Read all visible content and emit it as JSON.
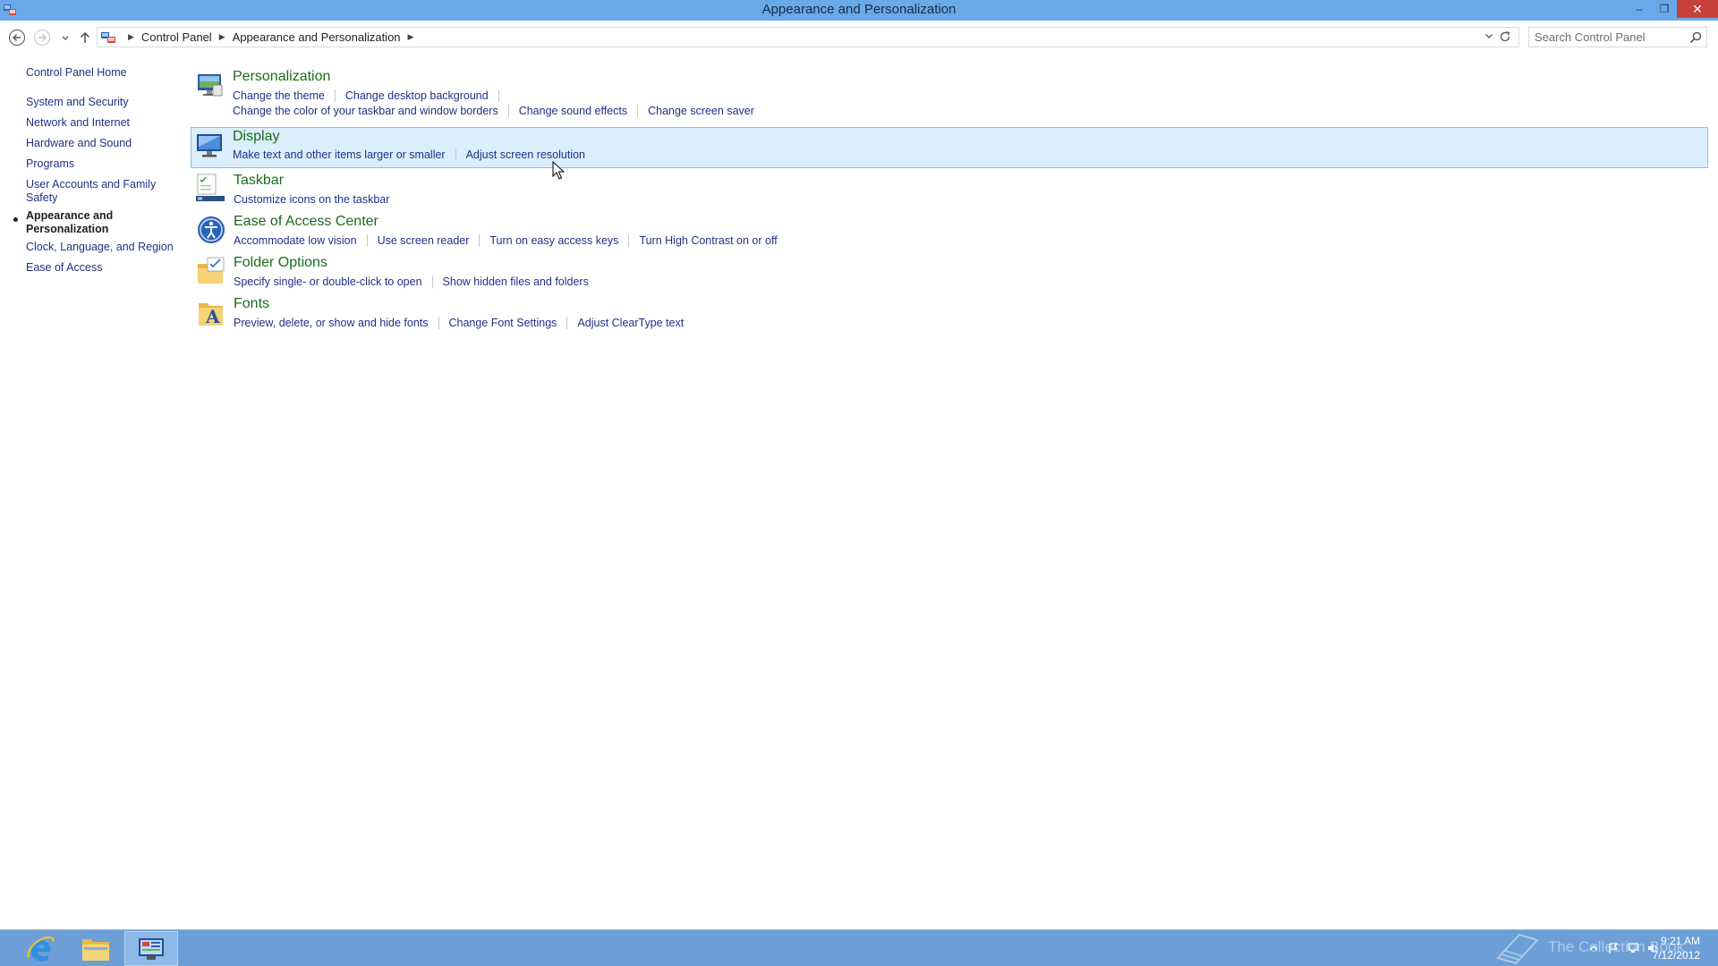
{
  "window": {
    "title": "Appearance and Personalization",
    "minimize": "–",
    "restore": "❐",
    "close": "✕"
  },
  "address": {
    "breadcrumbs": [
      "Control Panel",
      "Appearance and Personalization"
    ],
    "search_placeholder": "Search Control Panel"
  },
  "leftnav": {
    "home": "Control Panel Home",
    "items": [
      "System and Security",
      "Network and Internet",
      "Hardware and Sound",
      "Programs",
      "User Accounts and Family Safety",
      "Appearance and Personalization",
      "Clock, Language, and Region",
      "Ease of Access"
    ],
    "current": "Appearance and Personalization"
  },
  "categories": [
    {
      "title": "Personalization",
      "links": [
        "Change the theme",
        "Change desktop background",
        "Change the color of your taskbar and window borders",
        "Change sound effects",
        "Change screen saver"
      ]
    },
    {
      "title": "Display",
      "links": [
        "Make text and other items larger or smaller",
        "Adjust screen resolution"
      ]
    },
    {
      "title": "Taskbar",
      "links": [
        "Customize icons on the taskbar"
      ]
    },
    {
      "title": "Ease of Access Center",
      "links": [
        "Accommodate low vision",
        "Use screen reader",
        "Turn on easy access keys",
        "Turn High Contrast on or off"
      ]
    },
    {
      "title": "Folder Options",
      "links": [
        "Specify single- or double-click to open",
        "Show hidden files and folders"
      ]
    },
    {
      "title": "Fonts",
      "links": [
        "Preview, delete, or show and hide fonts",
        "Change Font Settings",
        "Adjust ClearType text"
      ]
    }
  ],
  "taskbar": {
    "apps": [
      "internet-explorer-icon",
      "file-explorer-icon",
      "control-panel-icon"
    ],
    "watermark": "The Collection Book",
    "time": "9:21 AM",
    "date": "7/12/2012"
  },
  "colors": {
    "titlebar": "#6aa9e9",
    "taskbar": "#6c9fd6",
    "link": "#1e3287",
    "category_title": "#1a6b1a",
    "highlight": "#dbeefb"
  }
}
